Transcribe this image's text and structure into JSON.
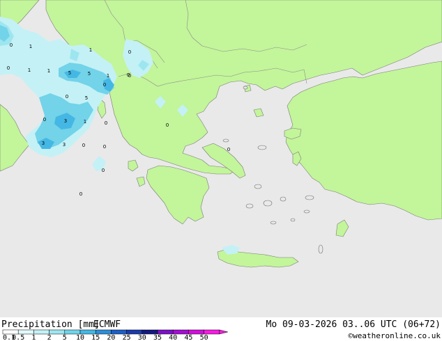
{
  "map": {
    "colors": {
      "sea": "#e9e9e9",
      "land": "#c3f59a",
      "border": "#8a8a8a",
      "coast": "#6e6e6e"
    },
    "precip_values": [
      {
        "label": "0"
      },
      {
        "label": "1"
      },
      {
        "label": "1"
      },
      {
        "label": "1"
      },
      {
        "label": "0"
      },
      {
        "label": "5"
      },
      {
        "label": "5"
      },
      {
        "label": "1"
      },
      {
        "label": "0"
      },
      {
        "label": "0"
      },
      {
        "label": "5"
      },
      {
        "label": "0"
      },
      {
        "label": "3"
      },
      {
        "label": "1"
      },
      {
        "label": "0"
      },
      {
        "label": "0"
      },
      {
        "label": "3"
      },
      {
        "label": "3"
      },
      {
        "label": "0"
      },
      {
        "label": "0"
      },
      {
        "label": "0"
      },
      {
        "label": "0"
      },
      {
        "label": "0"
      },
      {
        "label": "0"
      },
      {
        "label": "1"
      },
      {
        "label": "0"
      },
      {
        "label": "0"
      }
    ]
  },
  "footer": {
    "title": "Precipitation [mm]",
    "model": "ECMWF",
    "datetime": "Mo 09-03-2026 03..06 UTC (06+72)",
    "credit": "©weatheronline.co.uk",
    "legend": [
      {
        "label": "0.1",
        "color": "#ffffff"
      },
      {
        "label": "0.5",
        "color": "#e1f9fb"
      },
      {
        "label": "1",
        "color": "#c4f1f6"
      },
      {
        "label": "2",
        "color": "#9ee6ef"
      },
      {
        "label": "5",
        "color": "#72d3e9"
      },
      {
        "label": "10",
        "color": "#45b7e4"
      },
      {
        "label": "15",
        "color": "#2e8ed6"
      },
      {
        "label": "20",
        "color": "#1f5fc4"
      },
      {
        "label": "25",
        "color": "#1c3aa8"
      },
      {
        "label": "30",
        "color": "#14197e"
      },
      {
        "label": "35",
        "color": "#7a12c4"
      },
      {
        "label": "40",
        "color": "#a20fd0"
      },
      {
        "label": "45",
        "color": "#cf11d8"
      },
      {
        "label": "50",
        "color": "#f31ee0"
      }
    ]
  }
}
